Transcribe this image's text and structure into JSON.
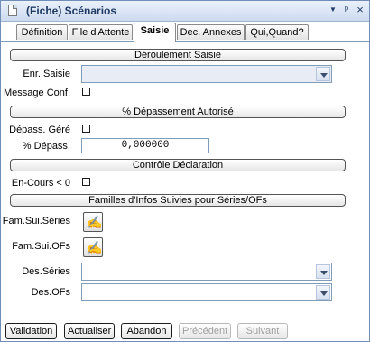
{
  "window": {
    "title": "(Fiche) Scénarios",
    "dropdown_glyph": "▼",
    "pin_glyph": "ᵖ",
    "close_glyph": "×"
  },
  "tabs": [
    {
      "label": "Définition"
    },
    {
      "label": "File d'Attente"
    },
    {
      "label": "Saisie",
      "active": true
    },
    {
      "label": "Dec. Annexes"
    },
    {
      "label": "Qui,Quand?"
    }
  ],
  "sections": {
    "deroulement": "Déroulement Saisie",
    "depassement": "% Dépassement Autorisé",
    "controle": "Contrôle Déclaration",
    "familles": "Familles d'Infos Suivies pour Séries/OFs"
  },
  "fields": {
    "enr_saisie": {
      "label": "Enr. Saisie",
      "value": ""
    },
    "message_conf": {
      "label": "Message Conf.",
      "checked": false
    },
    "depass_gere": {
      "label": "Dépass. Géré",
      "checked": false
    },
    "pct_depass": {
      "label": "% Dépass.",
      "value": "0,000000"
    },
    "en_cours": {
      "label": "En-Cours < 0",
      "checked": false
    },
    "fam_sui_series": {
      "label": "Fam.Sui.Séries"
    },
    "fam_sui_ofs": {
      "label": "Fam.Sui.OFs"
    },
    "des_series": {
      "label": "Des.Séries",
      "value": ""
    },
    "des_ofs": {
      "label": "Des.OFs",
      "value": ""
    }
  },
  "buttons": {
    "validation": "Validation",
    "actualiser": "Actualiser",
    "abandon": "Abandon",
    "precedent": "Précédent",
    "suivant": "Suivant"
  },
  "icons": {
    "fam_edit_glyph": "✍"
  },
  "colors": {
    "title_text": "#1f3a63",
    "field_border": "#7f9db9",
    "disabled_text": "#a0a0a0"
  }
}
